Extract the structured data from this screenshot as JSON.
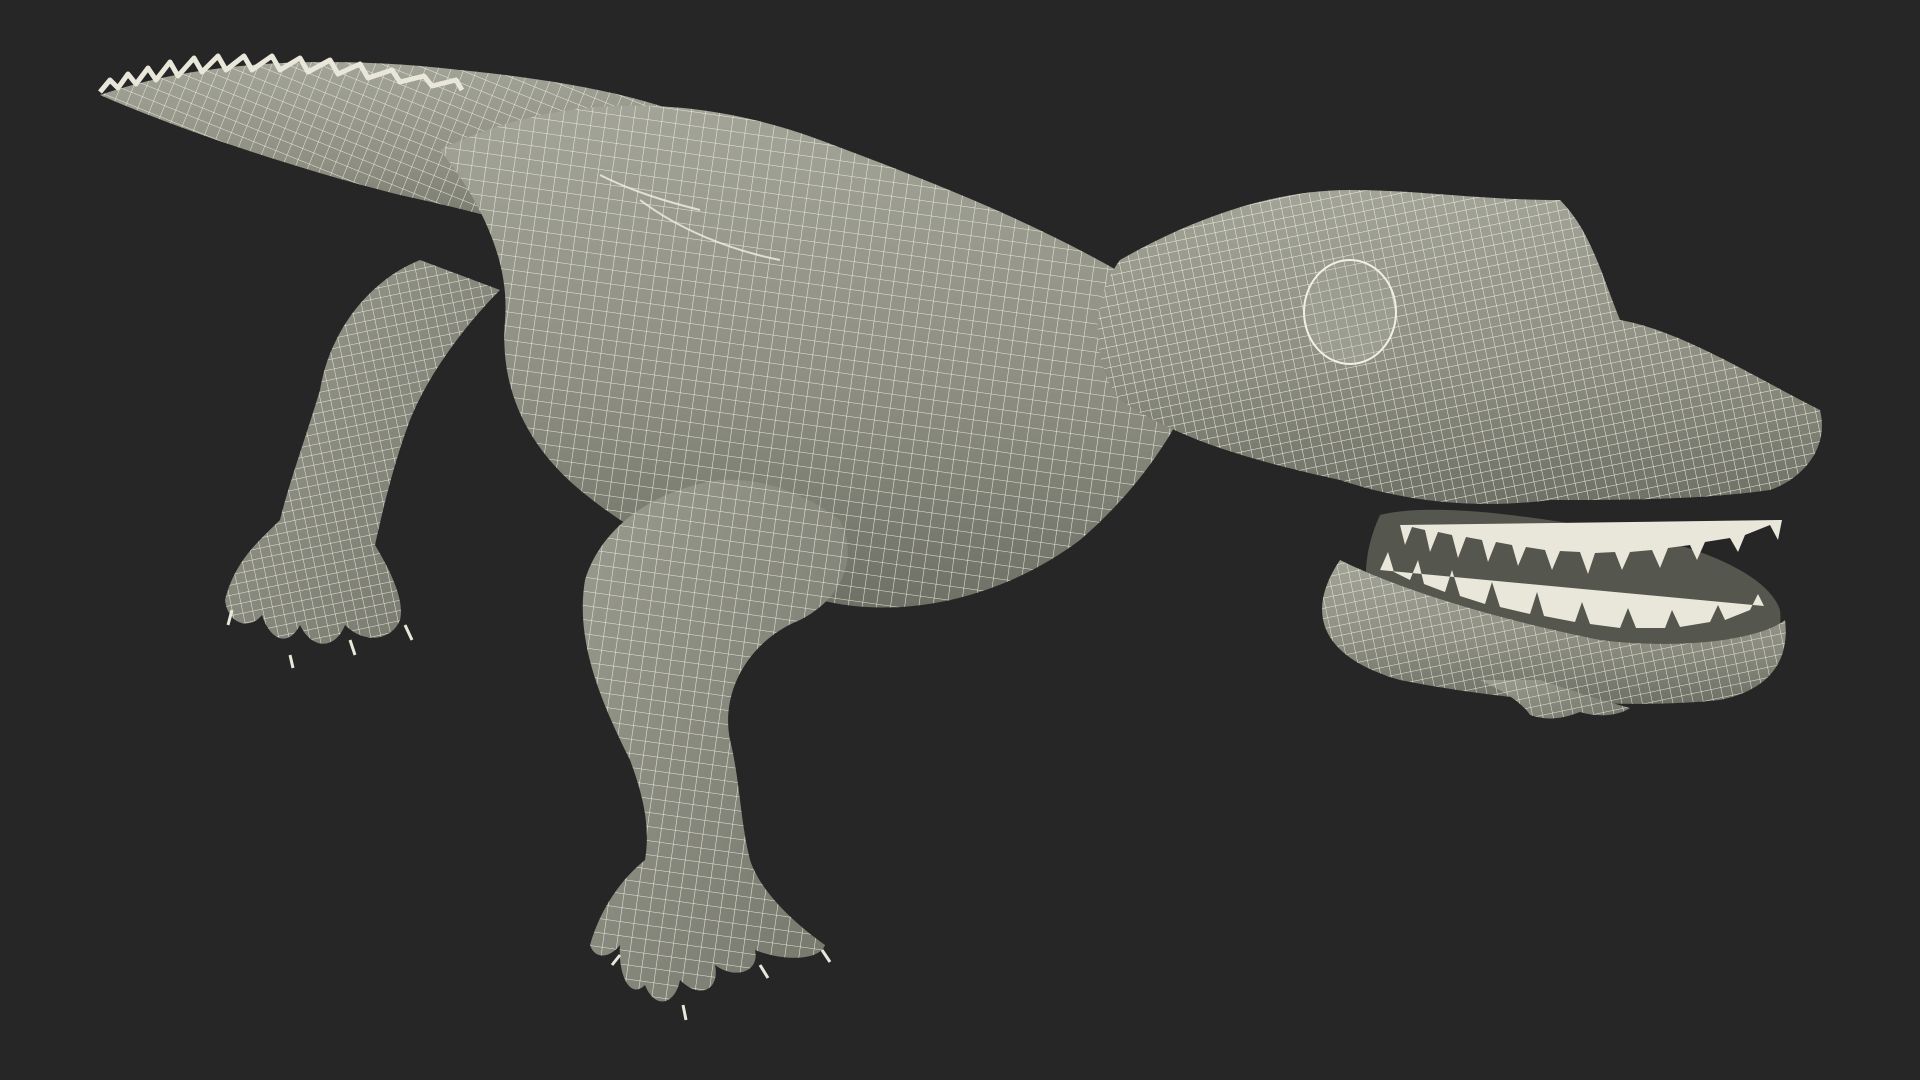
{
  "scene": {
    "subject": "alligator-wireframe-model",
    "colors": {
      "background": "#262626",
      "surface": "#8e8f82",
      "surface_light": "#a3a498",
      "surface_shadow": "#6f7066",
      "wire": "#f2f0e2",
      "mouth_interior": "#55564e",
      "teeth": "#e9e7da"
    }
  }
}
